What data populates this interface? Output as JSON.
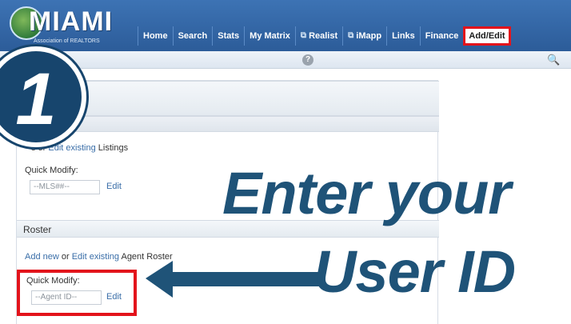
{
  "header": {
    "logo": {
      "word": "MIAMI",
      "subtitle": "Association of REALTORS"
    },
    "nav": [
      {
        "label": "Home",
        "external": false,
        "active": false
      },
      {
        "label": "Search",
        "external": false,
        "active": false
      },
      {
        "label": "Stats",
        "external": false,
        "active": false
      },
      {
        "label": "My Matrix",
        "external": false,
        "active": false
      },
      {
        "label": "Realist",
        "external": true,
        "active": false
      },
      {
        "label": "iMapp",
        "external": true,
        "active": false
      },
      {
        "label": "Links",
        "external": false,
        "active": false
      },
      {
        "label": "Finance",
        "external": false,
        "active": false
      },
      {
        "label": "Add/Edit",
        "external": false,
        "active": true
      }
    ]
  },
  "searchbar": {
    "help_icon": "question-icon",
    "search_icon": "magnifier-icon"
  },
  "listings": {
    "line": {
      "prefix": "s",
      "or": " or ",
      "edit_link": "Edit existing",
      "suffix": " Listings"
    },
    "quick_modify": {
      "label": "Quick Modify:",
      "placeholder": "--MLS##--",
      "edit": "Edit"
    }
  },
  "roster": {
    "title": "Roster",
    "line": {
      "add_link": "Add new",
      "or": " or ",
      "edit_link": "Edit existing",
      "suffix": " Agent Roster"
    },
    "quick_modify": {
      "label": "Quick Modify:",
      "placeholder": "--Agent ID--",
      "edit": "Edit"
    }
  },
  "overlay": {
    "step_number": "1",
    "callout_line1": "Enter your",
    "callout_line2": "User ID"
  },
  "colors": {
    "brand_blue": "#2c5c99",
    "highlight_red": "#e3131b",
    "callout_blue": "#1f5378"
  }
}
